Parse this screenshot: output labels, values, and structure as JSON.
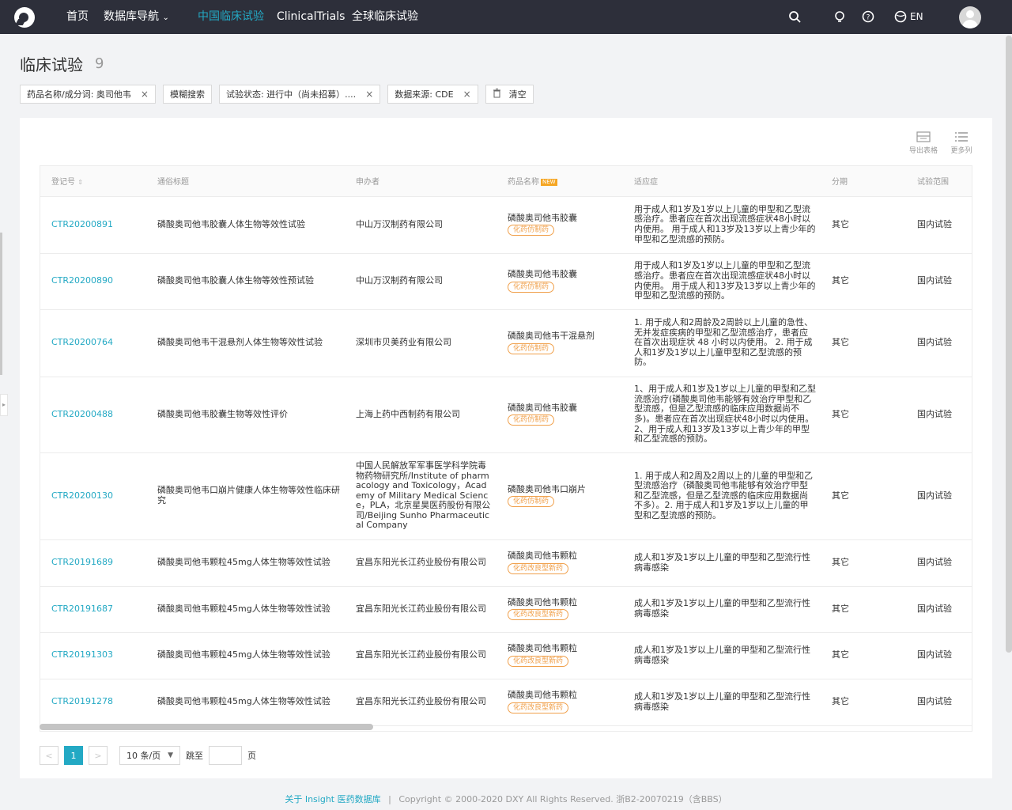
{
  "nav": {
    "items": [
      "首页",
      "数据库导航",
      "中国临床试验",
      "ClinicalTrials",
      "全球临床试验"
    ],
    "active_index": 2,
    "lang": "EN"
  },
  "header": {
    "title": "临床试验",
    "count": "9"
  },
  "filters": {
    "chips": [
      {
        "label": "药品名称/成分词: 奥司他韦",
        "closable": true
      },
      {
        "label": "模糊搜索",
        "closable": false
      },
      {
        "label": "试验状态: 进行中（尚未招募）....",
        "closable": true
      },
      {
        "label": "数据来源: CDE",
        "closable": true
      }
    ],
    "clear_label": "清空"
  },
  "tools": {
    "export": "导出表格",
    "columns": "更多列"
  },
  "table": {
    "headers": [
      "登记号",
      "通俗标题",
      "申办者",
      "药品名称",
      "适应症",
      "分期",
      "试验范围"
    ],
    "new_badge": "NEW",
    "rows": [
      {
        "reg": "CTR20200891",
        "title": "磷酸奥司他韦胶囊人体生物等效性试验",
        "sponsor": "中山万汉制药有限公司",
        "drug": "磷酸奥司他韦胶囊",
        "tag": "化药仿制药",
        "indication": "用于成人和1岁及1岁以上儿童的甲型和乙型流感治疗。患者应在首次出现流感症状48小时以内使用。 用于成人和13岁及13岁以上青少年的甲型和乙型流感的预防。",
        "phase": "其它",
        "scope": "国内试验"
      },
      {
        "reg": "CTR20200890",
        "title": "磷酸奥司他韦胶囊人体生物等效性预试验",
        "sponsor": "中山万汉制药有限公司",
        "drug": "磷酸奥司他韦胶囊",
        "tag": "化药仿制药",
        "indication": "用于成人和1岁及1岁以上儿童的甲型和乙型流感治疗。患者应在首次出现流感症状48小时以内使用。 用于成人和13岁及13岁以上青少年的甲型和乙型流感的预防。",
        "phase": "其它",
        "scope": "国内试验"
      },
      {
        "reg": "CTR20200764",
        "title": "磷酸奥司他韦干混悬剂人体生物等效性试验",
        "sponsor": "深圳市贝美药业有限公司",
        "drug": "磷酸奥司他韦干混悬剂",
        "tag": "化药仿制药",
        "indication": "1. 用于成人和2周龄及2周龄以上儿童的急性、无并发症疾病的甲型和乙型流感治疗，患者应在首次出现症状 48 小时以内使用。 2. 用于成人和1岁及1岁以上儿童甲型和乙型流感的预防。",
        "phase": "其它",
        "scope": "国内试验"
      },
      {
        "reg": "CTR20200488",
        "title": "磷酸奥司他韦胶囊生物等效性评价",
        "sponsor": "上海上药中西制药有限公司",
        "drug": "磷酸奥司他韦胶囊",
        "tag": "化药仿制药",
        "indication": "1、用于成人和1岁及1岁以上儿童的甲型和乙型流感治疗(磷酸奥司他韦能够有效治疗甲型和乙型流感，但是乙型流感的临床应用数据尚不多)。患者应在首次出现症状48小时以内使用。 2、用于成人和13岁及13岁以上青少年的甲型和乙型流感的预防。",
        "phase": "其它",
        "scope": "国内试验"
      },
      {
        "reg": "CTR20200130",
        "title": "磷酸奥司他韦口崩片健康人体生物等效性临床研究",
        "sponsor": "中国人民解放军军事医学科学院毒物药物研究所/Institute of pharmacology and Toxicology，Academy of Military Medical Science，PLA，北京星昊医药股份有限公司/Beijing Sunho Pharmaceutical Company",
        "drug": "磷酸奥司他韦口崩片",
        "tag": "化药仿制药",
        "indication": "1. 用于成人和2周及2周以上的儿童的甲型和乙型流感治疗（磷酸奥司他韦能够有效治疗甲型和乙型流感，但是乙型流感的临床应用数据尚不多）。2. 用于成人和1岁及1岁以上儿童的甲型和乙型流感的预防。",
        "phase": "其它",
        "scope": "国内试验"
      },
      {
        "reg": "CTR20191689",
        "title": "磷酸奥司他韦颗粒45mg人体生物等效性试验",
        "sponsor": "宜昌东阳光长江药业股份有限公司",
        "drug": "磷酸奥司他韦颗粒",
        "tag": "化药改良型新药",
        "indication": "成人和1岁及1岁以上儿童的甲型和乙型流行性病毒感染",
        "phase": "其它",
        "scope": "国内试验"
      },
      {
        "reg": "CTR20191687",
        "title": "磷酸奥司他韦颗粒45mg人体生物等效性试验",
        "sponsor": "宜昌东阳光长江药业股份有限公司",
        "drug": "磷酸奥司他韦颗粒",
        "tag": "化药改良型新药",
        "indication": "成人和1岁及1岁以上儿童的甲型和乙型流行性病毒感染",
        "phase": "其它",
        "scope": "国内试验"
      },
      {
        "reg": "CTR20191303",
        "title": "磷酸奥司他韦颗粒45mg人体生物等效性试验",
        "sponsor": "宜昌东阳光长江药业股份有限公司",
        "drug": "磷酸奥司他韦颗粒",
        "tag": "化药改良型新药",
        "indication": "成人和1岁及1岁以上儿童的甲型和乙型流行性病毒感染",
        "phase": "其它",
        "scope": "国内试验"
      },
      {
        "reg": "CTR20191278",
        "title": "磷酸奥司他韦颗粒45mg人体生物等效性试验",
        "sponsor": "宜昌东阳光长江药业股份有限公司",
        "drug": "磷酸奥司他韦颗粒",
        "tag": "化药改良型新药",
        "indication": "成人和1岁及1岁以上儿童的甲型和乙型流行性病毒感染",
        "phase": "其它",
        "scope": "国内试验"
      }
    ]
  },
  "pagination": {
    "prev": "<",
    "current": "1",
    "next": ">",
    "page_size": "10 条/页",
    "jump_label": "跳至",
    "page_label": "页"
  },
  "footer": {
    "link": "关于 Insight 医药数据库",
    "separator": "|",
    "copyright": "Copyright © 2000-2020 DXY All Rights Reserved. 浙B2-20070219（含BBS）"
  },
  "colors": {
    "accent": "#23a9c4",
    "nav_bg": "#2d2f3a",
    "tag": "#f0a04b"
  }
}
